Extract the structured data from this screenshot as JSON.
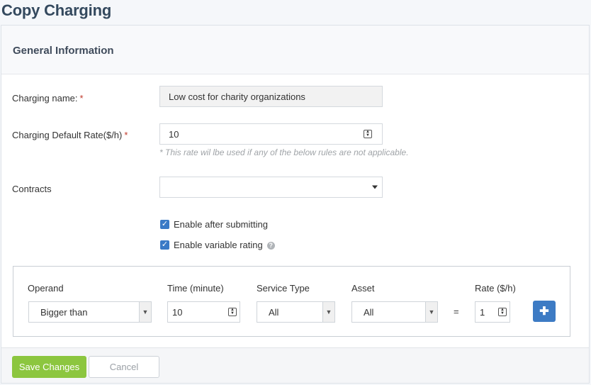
{
  "page": {
    "title": "Copy Charging"
  },
  "section": {
    "title": "General Information"
  },
  "form": {
    "charging_name": {
      "label": "Charging name:",
      "required_mark": "*",
      "value": "Low cost for charity organizations"
    },
    "default_rate": {
      "label": "Charging Default Rate($/h)",
      "required_mark": "*",
      "value": "10",
      "hint": "* This rate wil lbe used if any of the below rules are not applicable."
    },
    "contracts": {
      "label": "Contracts",
      "value": ""
    },
    "enable_after_submitting": {
      "label": "Enable after submitting",
      "checked": true
    },
    "enable_variable_rating": {
      "label": "Enable variable rating",
      "checked": true,
      "help_icon": "question-icon"
    }
  },
  "rules": {
    "headers": {
      "operand": "Operand",
      "time": "Time (minute)",
      "service_type": "Service Type",
      "asset": "Asset",
      "rate": "Rate ($/h)"
    },
    "row": {
      "operand": "Bigger than",
      "time": "10",
      "service_type": "All",
      "asset": "All",
      "equals": "=",
      "rate": "1"
    },
    "add_icon": "plus-icon"
  },
  "footer": {
    "save_label": "Save Changes",
    "cancel_label": "Cancel"
  },
  "colors": {
    "accent": "#3a7ac6",
    "save": "#8cc63f",
    "title": "#34495e"
  }
}
